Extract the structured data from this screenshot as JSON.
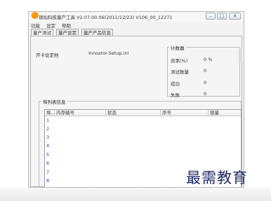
{
  "window": {
    "title": "银灿科技量产工具 V2.07.00.06(2011/12/23)   V106_00_12271",
    "buttons": {
      "minimize": "–",
      "restore": "□",
      "close": "✕"
    },
    "app_icon": "orange-c-icon"
  },
  "menu": [
    "功能",
    "设定",
    "帮助"
  ],
  "tabs": [
    "量产测试",
    "量产设定",
    "量产产品信息"
  ],
  "settings": {
    "label": "开卡设定档",
    "value": "Innostor-Setup.ini"
  },
  "counter": {
    "title": "计数器",
    "rows": [
      {
        "label": "良率(%)",
        "value": "0 %"
      },
      {
        "label": "测试数量",
        "value": "0"
      },
      {
        "label": "成功",
        "value": "0"
      },
      {
        "label": "失败",
        "value": "0"
      }
    ]
  },
  "list": {
    "title": "埠列表信息",
    "columns": [
      "埠...",
      "内存编号",
      "状态",
      "序号",
      "容量"
    ],
    "rows": [
      "1",
      "2",
      "3",
      "4",
      "5",
      "6",
      "7",
      "8"
    ]
  },
  "watermark": "最需教育"
}
